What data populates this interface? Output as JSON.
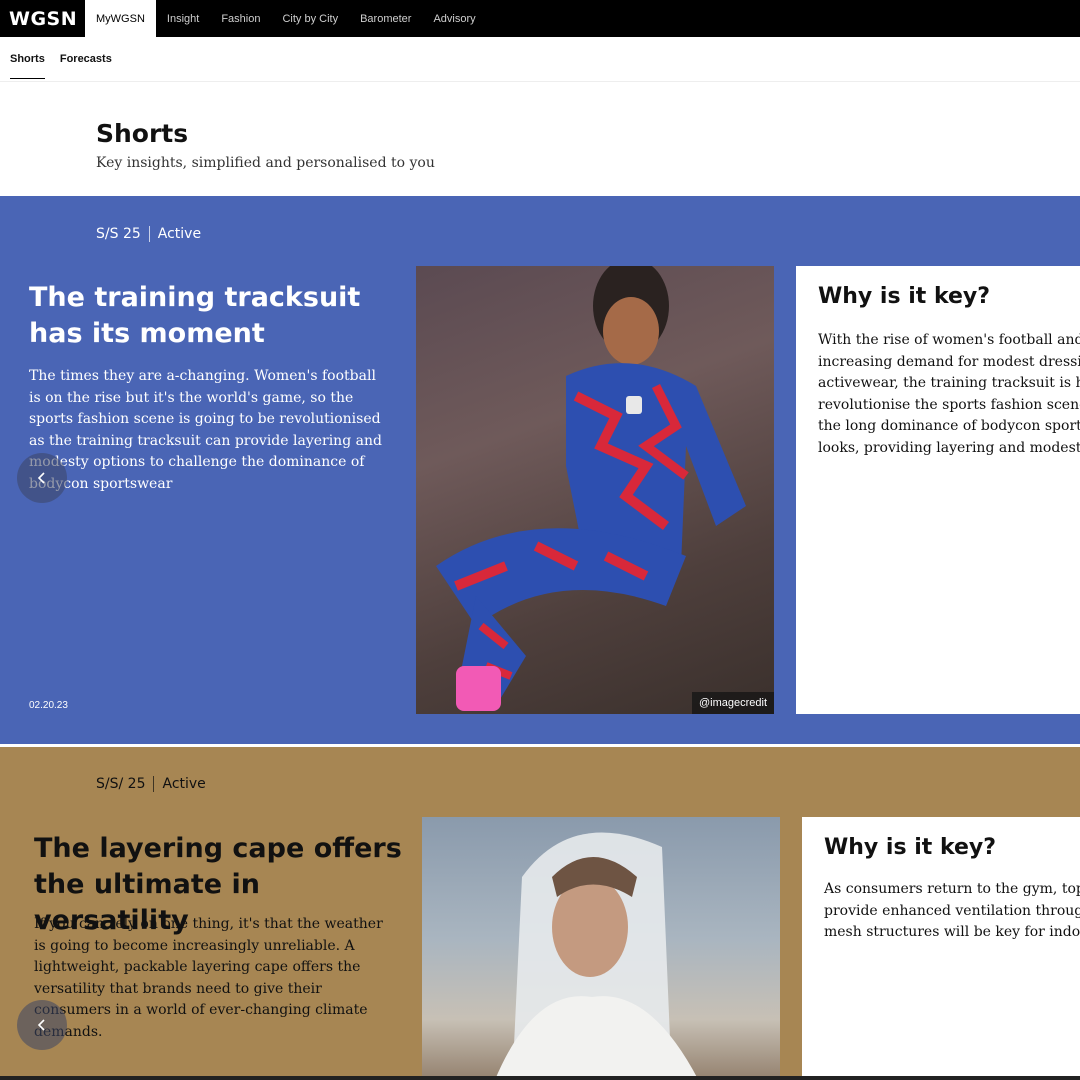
{
  "nav": {
    "logo": "WGSN",
    "items": [
      "MyWGSN",
      "Insight",
      "Fashion",
      "City by City",
      "Barometer",
      "Advisory"
    ]
  },
  "subnav": {
    "items": [
      "Shorts",
      "Forecasts"
    ]
  },
  "header": {
    "title": "Shorts",
    "subtitle": "Key insights, simplified and personalised to you"
  },
  "cards": [
    {
      "season": "S/S 25",
      "category": "Active",
      "title": "The training tracksuit has its moment",
      "body": "The times they are a-changing. Women's football is on the rise but it's the world's game, so the sports fashion scene is going to be revolutionised as the training tracksuit can provide layering and modesty options to challenge the dominance of bodycon sportswear",
      "date": "02.20.23",
      "image_credit": "@imagecredit",
      "why_title": "Why is it key?",
      "why_lines": [
        "With the rise of women's football and the",
        "increasing demand for modest dressing in",
        "activewear, the training tracksuit is here to",
        "revolutionise the sports fashion scene. It",
        "the long dominance of bodycon sportswe",
        "looks, providing layering and modesty op"
      ],
      "bg_color": "#4a65b5"
    },
    {
      "season": "S/S/ 25",
      "category": "Active",
      "title": "The layering cape offers the ultimate in versatility",
      "body": "If you can rely on one thing, it's that the weather is going to become increasingly unreliable. A lightweight, packable layering cape offers the versatility that brands need to give their consumers in a world of ever-changing climate demands.",
      "why_title": "Why is it key?",
      "why_lines": [
        "As consumers return to the gym, tops wh",
        "provide enhanced ventilation through cr",
        "mesh structures will be key for indoor w"
      ],
      "bg_color": "#a78653"
    }
  ],
  "icons": {
    "prev_arrow": "chevron-left-icon"
  }
}
